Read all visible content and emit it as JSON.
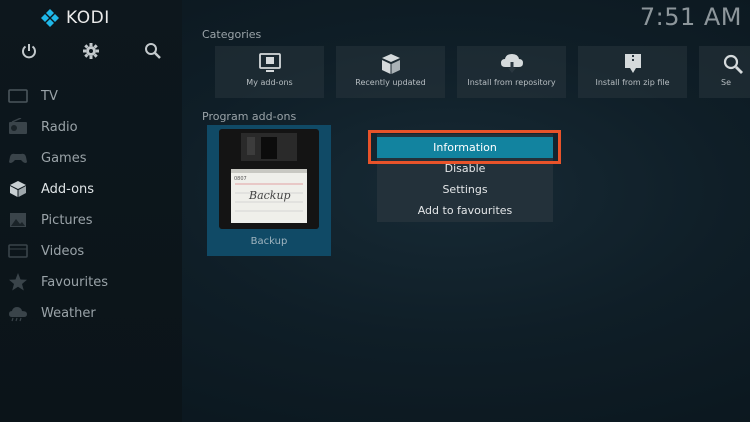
{
  "app": {
    "name": "KODI",
    "clock": "7:51 AM"
  },
  "top_icons": [
    {
      "name": "power-icon"
    },
    {
      "name": "settings-icon"
    },
    {
      "name": "search-icon"
    }
  ],
  "sidebar": {
    "items": [
      {
        "label": "TV",
        "icon": "tv-icon"
      },
      {
        "label": "Radio",
        "icon": "radio-icon"
      },
      {
        "label": "Games",
        "icon": "gamepad-icon"
      },
      {
        "label": "Add-ons",
        "icon": "box-icon",
        "active": true
      },
      {
        "label": "Pictures",
        "icon": "picture-icon"
      },
      {
        "label": "Videos",
        "icon": "film-icon"
      },
      {
        "label": "Favourites",
        "icon": "star-icon"
      },
      {
        "label": "Weather",
        "icon": "cloud-icon"
      }
    ]
  },
  "categories": {
    "title": "Categories",
    "items": [
      {
        "label": "My add-ons",
        "icon": "monitor-box-icon"
      },
      {
        "label": "Recently updated",
        "icon": "open-box-icon"
      },
      {
        "label": "Install from repository",
        "icon": "cloud-download-icon"
      },
      {
        "label": "Install from zip file",
        "icon": "zip-install-icon"
      },
      {
        "label": "Se",
        "icon": "search-icon"
      }
    ]
  },
  "program_addons": {
    "title": "Program add-ons",
    "items": [
      {
        "label": "Backup",
        "image_text": "Backup",
        "image_tag": "0807"
      }
    ]
  },
  "context_menu": {
    "items": [
      {
        "label": "Information",
        "focused": true
      },
      {
        "label": "Disable"
      },
      {
        "label": "Settings"
      },
      {
        "label": "Add to favourites"
      }
    ]
  },
  "colors": {
    "accent": "#12839f",
    "highlight_border": "#e8532a",
    "tile_selected": "#104a66"
  }
}
